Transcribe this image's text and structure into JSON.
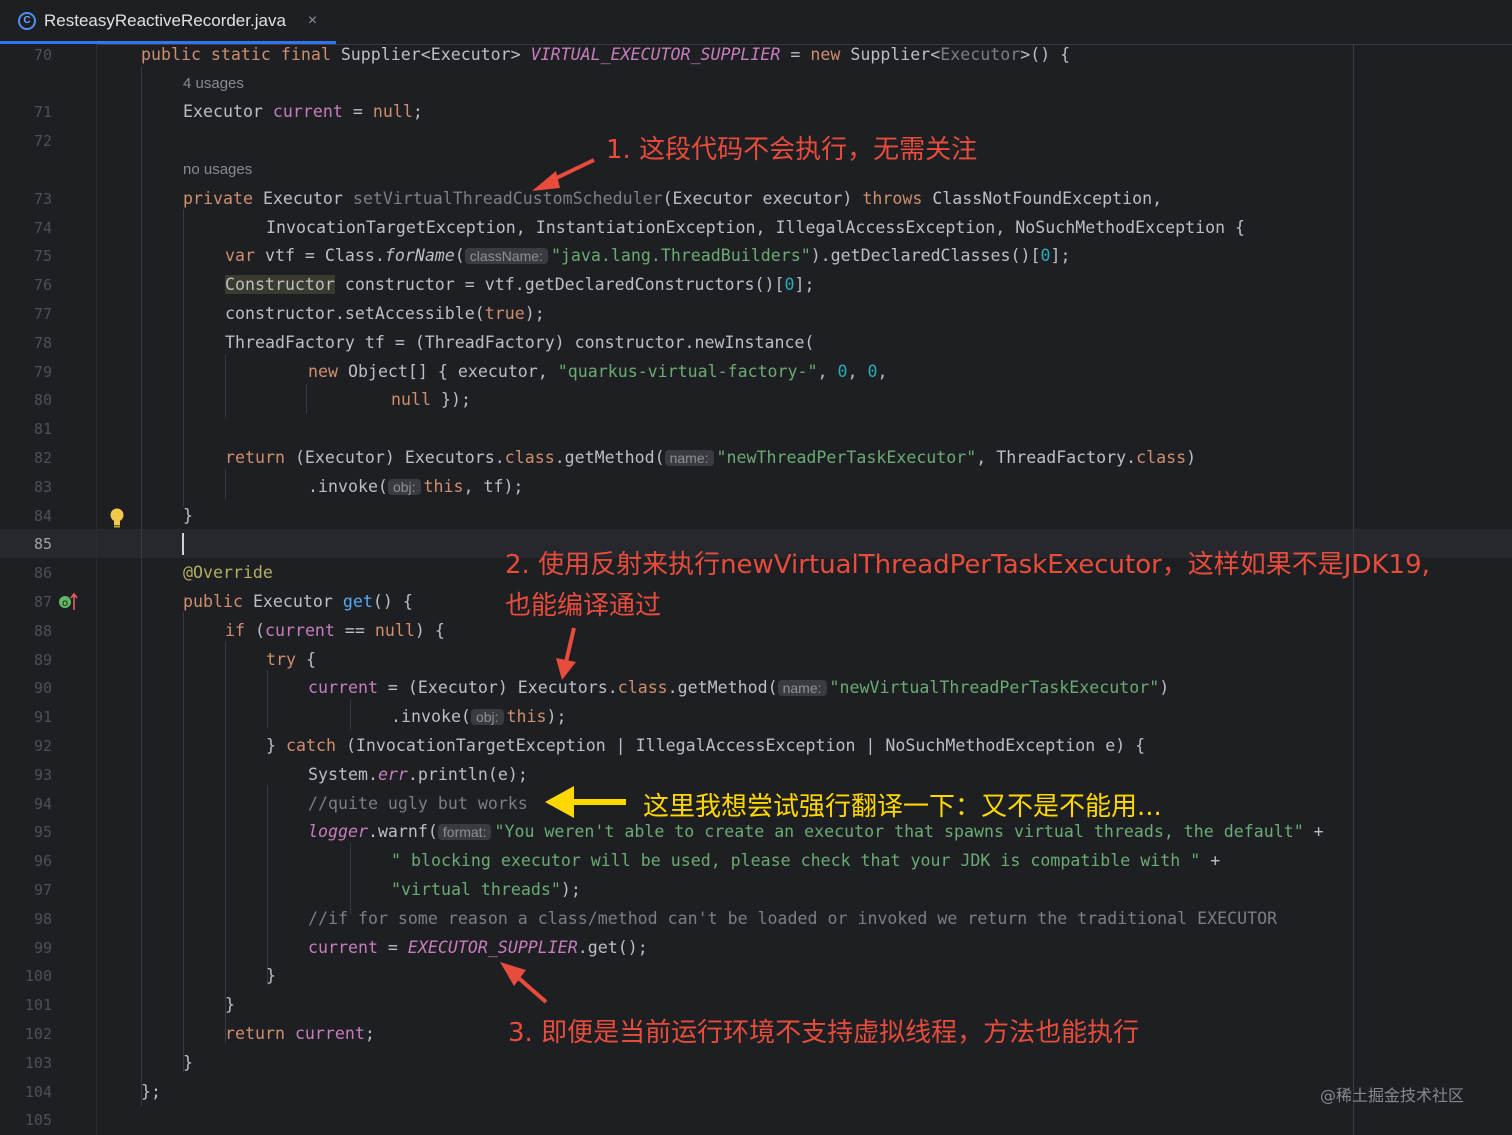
{
  "tab": {
    "file_name": "ResteasyReactiveRecorder.java",
    "icon": "java-class-icon",
    "close": "×"
  },
  "editor": {
    "current_line": 85,
    "inlay_hints": {
      "usages_70": "4 usages",
      "usages_72": "no usages",
      "class_name": "className:",
      "name": "name:",
      "obj": "obj:",
      "format": "format:"
    },
    "lines": [
      {
        "n": "70",
        "code": "public static final Supplier<Executor> VIRTUAL_EXECUTOR_SUPPLIER = new Supplier<Executor>() {"
      },
      {
        "n": "71",
        "code": "Executor current = null;"
      },
      {
        "n": "72",
        "code": ""
      },
      {
        "n": "73",
        "code": "private Executor setVirtualThreadCustomScheduler(Executor executor) throws ClassNotFoundException,"
      },
      {
        "n": "74",
        "code": "InvocationTargetException, InstantiationException, IllegalAccessException, NoSuchMethodException {"
      },
      {
        "n": "75",
        "code": "var vtf = Class.forName(className: \"java.lang.ThreadBuilders\").getDeclaredClasses()[0];"
      },
      {
        "n": "76",
        "code": "Constructor constructor = vtf.getDeclaredConstructors()[0];"
      },
      {
        "n": "77",
        "code": "constructor.setAccessible(true);"
      },
      {
        "n": "78",
        "code": "ThreadFactory tf = (ThreadFactory) constructor.newInstance("
      },
      {
        "n": "79",
        "code": "new Object[] { executor, \"quarkus-virtual-factory-\", 0, 0,"
      },
      {
        "n": "80",
        "code": "null });"
      },
      {
        "n": "81",
        "code": ""
      },
      {
        "n": "82",
        "code": "return (Executor) Executors.class.getMethod(name: \"newThreadPerTaskExecutor\", ThreadFactory.class)"
      },
      {
        "n": "83",
        "code": ".invoke(obj: this, tf);"
      },
      {
        "n": "84",
        "code": "}"
      },
      {
        "n": "85",
        "code": ""
      },
      {
        "n": "86",
        "code": "@Override"
      },
      {
        "n": "87",
        "code": "public Executor get() {"
      },
      {
        "n": "88",
        "code": "if (current == null) {"
      },
      {
        "n": "89",
        "code": "try {"
      },
      {
        "n": "90",
        "code": "current = (Executor) Executors.class.getMethod(name: \"newVirtualThreadPerTaskExecutor\")"
      },
      {
        "n": "91",
        "code": ".invoke(obj: this);"
      },
      {
        "n": "92",
        "code": "} catch (InvocationTargetException | IllegalAccessException | NoSuchMethodException e) {"
      },
      {
        "n": "93",
        "code": "System.err.println(e);"
      },
      {
        "n": "94",
        "code": "//quite ugly but works"
      },
      {
        "n": "95",
        "code": "logger.warnf(format: \"You weren't able to create an executor that spawns virtual threads, the default\" +"
      },
      {
        "n": "96",
        "code": "\" blocking executor will be used, please check that your JDK is compatible with \" +"
      },
      {
        "n": "97",
        "code": "\"virtual threads\");"
      },
      {
        "n": "98",
        "code": "//if for some reason a class/method can't be loaded or invoked we return the traditional EXECUTOR"
      },
      {
        "n": "99",
        "code": "current = EXECUTOR_SUPPLIER.get();"
      },
      {
        "n": "100",
        "code": "}"
      },
      {
        "n": "101",
        "code": "}"
      },
      {
        "n": "102",
        "code": "return current;"
      },
      {
        "n": "103",
        "code": "}"
      },
      {
        "n": "104",
        "code": "};"
      },
      {
        "n": "105",
        "code": ""
      }
    ]
  },
  "annotations": {
    "a1": "1. 这段代码不会执行，无需关注",
    "a2_line1": "2. 使用反射来执行newVirtualThreadPerTaskExecutor，这样如果不是JDK19,",
    "a2_line2": "也能编译通过",
    "a3": "这里我想尝试强行翻译一下：又不是不能用...",
    "a4": "3. 即便是当前运行环境不支持虚拟线程，方法也能执行"
  },
  "watermark": "@稀土掘金技术社区",
  "colors": {
    "background": "#1e1f22",
    "keyword": "#cf8e6d",
    "string": "#6aab73",
    "number": "#2aacb8",
    "field": "#c77dbb",
    "method": "#56a8f5",
    "annotation_red": "#e74c3c",
    "annotation_yellow": "#ffd800",
    "tab_underline": "#3574f0"
  }
}
